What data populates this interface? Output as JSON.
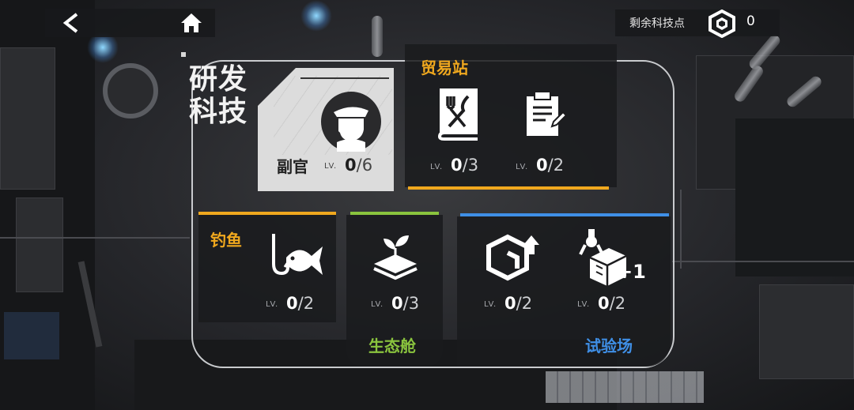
{
  "header": {
    "remaining_points_label": "剩余科技点",
    "remaining_points_value": "0"
  },
  "page_title": {
    "line1": "研发",
    "line2": "科技"
  },
  "lv_prefix": "LV.",
  "adjutant": {
    "label": "副官",
    "level": "0",
    "max": "/6"
  },
  "trade_station": {
    "title": "贸易站",
    "accent": "#f0a81e",
    "items": [
      {
        "icon": "dining-book-icon",
        "level": "0",
        "max": "/3"
      },
      {
        "icon": "clipboard-icon",
        "level": "0",
        "max": "/2"
      }
    ]
  },
  "fishing": {
    "title": "钓鱼",
    "accent": "#f0a81e",
    "items": [
      {
        "icon": "hooked-fish-icon",
        "level": "0",
        "max": "/2"
      }
    ]
  },
  "ecopod": {
    "title": "生态舱",
    "accent": "#8ac43e",
    "items": [
      {
        "icon": "sprout-layers-icon",
        "level": "0",
        "max": "/3"
      }
    ]
  },
  "testing_ground": {
    "title": "试验场",
    "accent": "#3f8fe6",
    "items": [
      {
        "icon": "cube-upgrade-icon",
        "level": "0",
        "max": "/2"
      },
      {
        "icon": "robot-arm-plus-one-icon",
        "level": "0",
        "max": "/2",
        "badge": "+1"
      }
    ]
  }
}
